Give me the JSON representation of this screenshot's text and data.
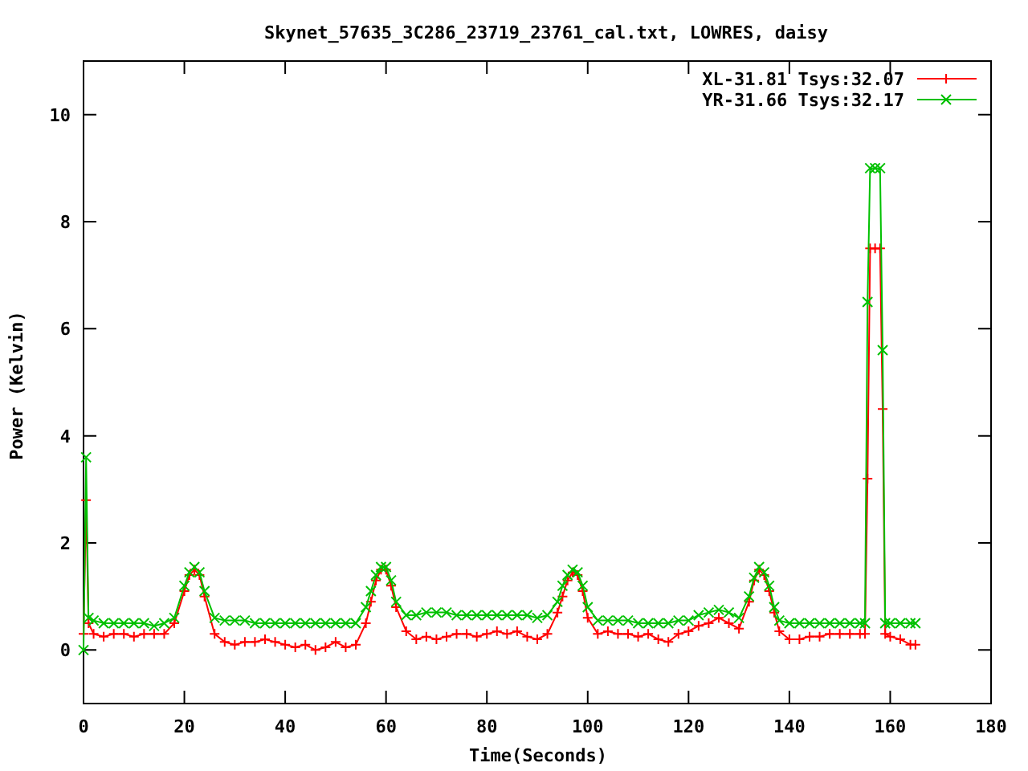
{
  "chart": {
    "chart_data": {
      "type": "line",
      "title": "Skynet_57635_3C286_23719_23761_cal.txt, LOWRES, daisy",
      "xlabel": "Time(Seconds)",
      "ylabel": "Power (Kelvin)",
      "x": [
        0,
        0.5,
        1,
        2,
        4,
        6,
        8,
        10,
        12,
        14,
        16,
        18,
        20,
        21,
        22,
        23,
        24,
        26,
        28,
        30,
        32,
        34,
        36,
        38,
        40,
        42,
        44,
        46,
        48,
        50,
        52,
        54,
        56,
        57,
        58,
        59,
        60,
        61,
        62,
        64,
        66,
        68,
        70,
        72,
        74,
        76,
        78,
        80,
        82,
        84,
        86,
        88,
        90,
        92,
        94,
        95,
        96,
        97,
        98,
        99,
        100,
        102,
        104,
        106,
        108,
        110,
        112,
        114,
        116,
        118,
        120,
        122,
        124,
        126,
        128,
        130,
        132,
        133,
        134,
        135,
        136,
        137,
        138,
        140,
        142,
        144,
        146,
        148,
        150,
        152,
        154,
        155,
        155.5,
        156,
        157,
        158,
        158.5,
        159,
        160,
        162,
        164,
        165
      ],
      "series": [
        {
          "name": "XL-31.81 Tsys:32.07",
          "color": "#ff0000",
          "marker": "plus",
          "values": [
            0.3,
            2.8,
            0.5,
            0.3,
            0.25,
            0.3,
            0.3,
            0.25,
            0.3,
            0.3,
            0.3,
            0.5,
            1.1,
            1.4,
            1.5,
            1.4,
            1.0,
            0.3,
            0.15,
            0.1,
            0.15,
            0.15,
            0.2,
            0.15,
            0.1,
            0.05,
            0.1,
            0.0,
            0.05,
            0.15,
            0.05,
            0.1,
            0.5,
            0.9,
            1.3,
            1.5,
            1.5,
            1.2,
            0.8,
            0.35,
            0.2,
            0.25,
            0.2,
            0.25,
            0.3,
            0.3,
            0.25,
            0.3,
            0.35,
            0.3,
            0.35,
            0.25,
            0.2,
            0.3,
            0.7,
            1.0,
            1.3,
            1.45,
            1.4,
            1.1,
            0.6,
            0.3,
            0.35,
            0.3,
            0.3,
            0.25,
            0.3,
            0.2,
            0.15,
            0.3,
            0.35,
            0.45,
            0.5,
            0.6,
            0.5,
            0.4,
            0.9,
            1.3,
            1.5,
            1.4,
            1.1,
            0.7,
            0.35,
            0.2,
            0.2,
            0.25,
            0.25,
            0.3,
            0.3,
            0.3,
            0.3,
            0.3,
            3.2,
            7.5,
            7.5,
            7.5,
            4.5,
            0.3,
            0.25,
            0.2,
            0.1,
            0.1
          ]
        },
        {
          "name": "YR-31.66 Tsys:32.17",
          "color": "#00c000",
          "marker": "x",
          "values": [
            0.0,
            3.6,
            0.6,
            0.55,
            0.5,
            0.5,
            0.5,
            0.5,
            0.5,
            0.45,
            0.5,
            0.6,
            1.2,
            1.45,
            1.55,
            1.45,
            1.1,
            0.6,
            0.55,
            0.55,
            0.55,
            0.5,
            0.5,
            0.5,
            0.5,
            0.5,
            0.5,
            0.5,
            0.5,
            0.5,
            0.5,
            0.5,
            0.8,
            1.1,
            1.4,
            1.55,
            1.55,
            1.3,
            0.9,
            0.65,
            0.65,
            0.7,
            0.7,
            0.7,
            0.65,
            0.65,
            0.65,
            0.65,
            0.65,
            0.65,
            0.65,
            0.65,
            0.6,
            0.65,
            0.9,
            1.2,
            1.4,
            1.5,
            1.45,
            1.2,
            0.8,
            0.55,
            0.55,
            0.55,
            0.55,
            0.5,
            0.5,
            0.5,
            0.5,
            0.55,
            0.55,
            0.65,
            0.7,
            0.75,
            0.7,
            0.6,
            1.0,
            1.35,
            1.55,
            1.45,
            1.2,
            0.8,
            0.55,
            0.5,
            0.5,
            0.5,
            0.5,
            0.5,
            0.5,
            0.5,
            0.5,
            0.5,
            6.5,
            9,
            9,
            9,
            5.6,
            0.5,
            0.5,
            0.5,
            0.5,
            0.5
          ]
        }
      ],
      "legend": "upper right",
      "xlim": [
        0,
        180
      ],
      "ylim": [
        -1,
        11
      ],
      "xticks": [
        0,
        20,
        40,
        60,
        80,
        100,
        120,
        140,
        160,
        180
      ],
      "yticks": [
        0,
        2,
        4,
        6,
        8,
        10
      ]
    }
  }
}
